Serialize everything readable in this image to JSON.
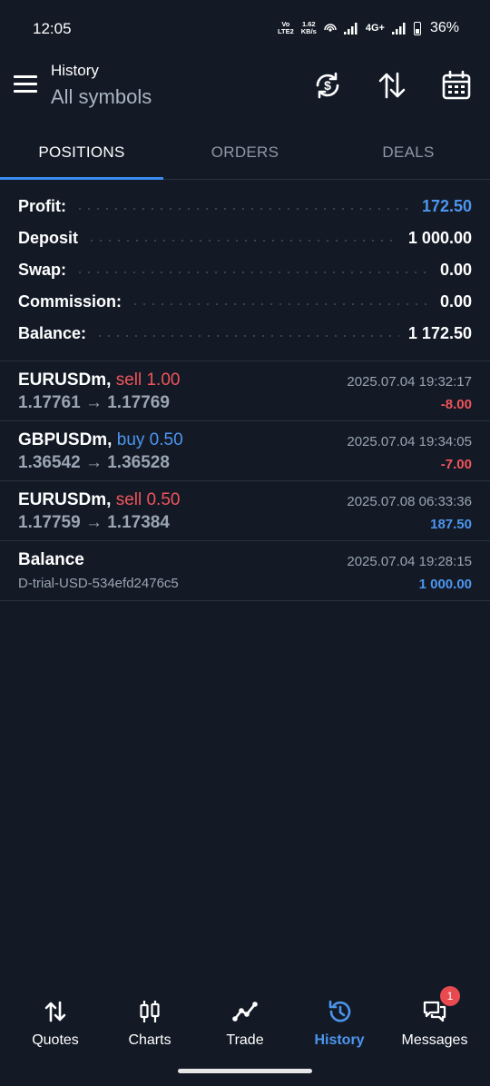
{
  "status": {
    "time": "12:05",
    "volte": "VoLTE2",
    "speed_value": "1.62",
    "speed_unit": "KB/s",
    "network": "4G+",
    "battery": "36%"
  },
  "header": {
    "subtitle": "History",
    "title": "All symbols"
  },
  "tabs": [
    {
      "label": "POSITIONS",
      "active": true
    },
    {
      "label": "ORDERS",
      "active": false
    },
    {
      "label": "DEALS",
      "active": false
    }
  ],
  "summary": {
    "profit": {
      "label": "Profit:",
      "value": "172.50"
    },
    "deposit": {
      "label": "Deposit",
      "value": "1 000.00"
    },
    "swap": {
      "label": "Swap:",
      "value": "0.00"
    },
    "commission": {
      "label": "Commission:",
      "value": "0.00"
    },
    "balance": {
      "label": "Balance:",
      "value": "1 172.50"
    }
  },
  "deals": [
    {
      "symbol": "EURUSDm,",
      "side": "sell 1.00",
      "prices": "1.17761 → 1.17769",
      "time": "2025.07.04 19:32:17",
      "profit": "-8.00"
    },
    {
      "symbol": "GBPUSDm,",
      "side": "buy 0.50",
      "prices": "1.36542 → 1.36528",
      "time": "2025.07.04 19:34:05",
      "profit": "-7.00"
    },
    {
      "symbol": "EURUSDm,",
      "side": "sell 0.50",
      "prices": "1.17759 → 1.17384",
      "time": "2025.07.08 06:33:36",
      "profit": "187.50"
    },
    {
      "symbol": "Balance",
      "sub": "D-trial-USD-534efd2476c5",
      "time": "2025.07.04 19:28:15",
      "profit": "1 000.00"
    }
  ],
  "nav": {
    "quotes": "Quotes",
    "charts": "Charts",
    "trade": "Trade",
    "history": "History",
    "messages": "Messages",
    "messages_badge": "1"
  },
  "colors": {
    "background": "#131a26",
    "accent": "#4d95ee",
    "negative": "#f0545a"
  }
}
